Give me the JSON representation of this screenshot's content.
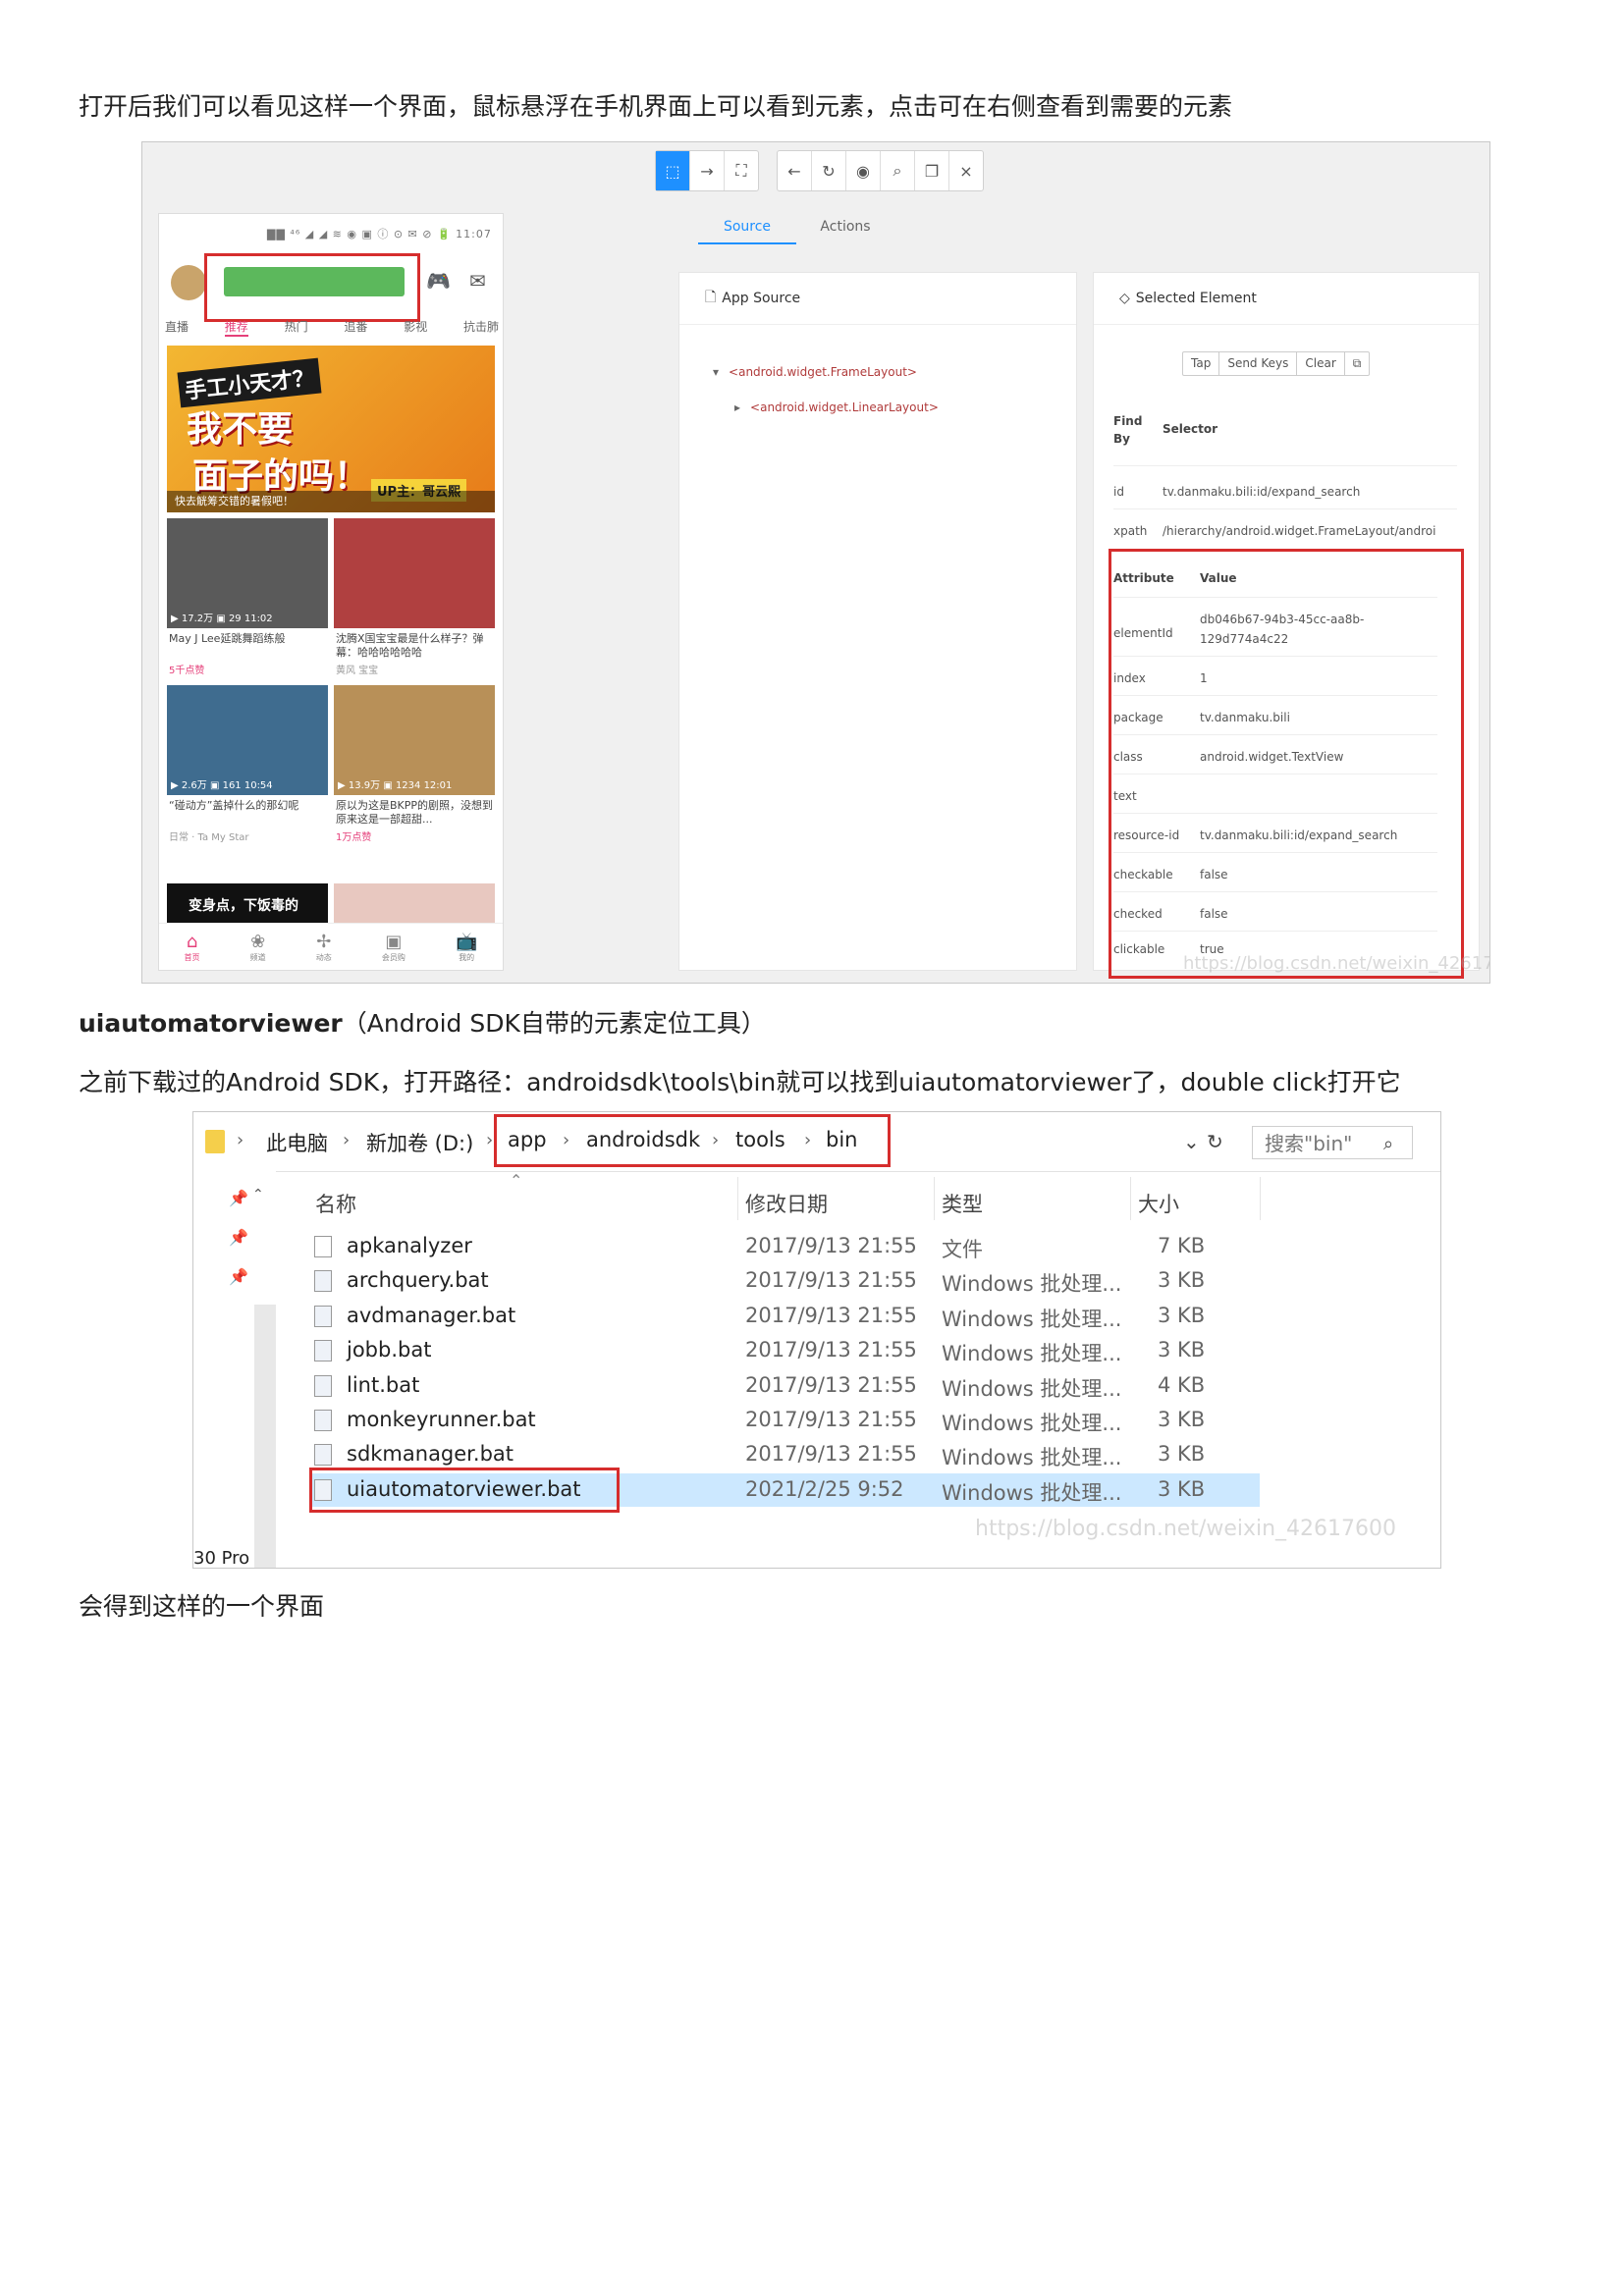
{
  "paragraphs": {
    "p1": "打开后我们可以看见这样一个界面，鼠标悬浮在手机界面上可以看到元素，点击可在右侧查看到需要的元素",
    "p2_bold": "uiautomatorviewer",
    "p2_rest": "（Android SDK自带的元素定位工具）",
    "p3": "之前下载过的Android SDK，打开路径：androidsdk\\tools\\bin就可以找到uiautomatorviewer了，double click打开它",
    "p4": "会得到这样的一个界面"
  },
  "inspector": {
    "toolbar_icons": [
      "select-icon",
      "swipe-icon",
      "tap-by-coordinates-icon",
      "back-icon",
      "refresh-icon",
      "eye-icon",
      "search-icon",
      "copy-icon",
      "close-icon"
    ],
    "tabs": [
      "Source",
      "Actions"
    ],
    "phone": {
      "status": "▇▇ ⁴⁶ ◢ ◢ ≋ ◉ ▣ ⓘ ⊙ ✉ ⊘ 🔋 11:07",
      "categories": [
        "直播",
        "推荐",
        "热门",
        "追番",
        "影视",
        "抗击肺"
      ],
      "banner": {
        "line1": "手工小天才？",
        "line2": "我不要",
        "line3": "面子的吗！",
        "up": "UP主：哥云熙",
        "foot": "快去觥筹交错的暑假吧！"
      },
      "cards": [
        {
          "stats": "▶ 17.2万  ▣ 29    11:02",
          "title": "May J Lee延跳舞蹈练般",
          "meta": "5千点赞"
        },
        {
          "stats": "",
          "title": "沈腾X国宝宝最是什么样子？弹幕：哈哈哈哈哈哈",
          "meta": "黄风 宝宝"
        },
        {
          "stats": "▶ 2.6万  ▣ 161   10:54",
          "title": "“碰动方”盖掉什么的那幻呢",
          "meta": "日常 · Ta My Star"
        },
        {
          "stats": "▶ 13.9万 ▣ 1234  12:01",
          "title": "原以为这是BKPP的剧照，没想到原来这是一部超甜...",
          "meta": "1万点赞"
        },
        {
          "stats": "",
          "title": "",
          "meta": ""
        },
        {
          "stats": "",
          "title": "",
          "meta": ""
        }
      ],
      "card5_text": "变身点，下饭毒的",
      "nav": [
        "首页",
        "频道",
        "动态",
        "会员购",
        "我的"
      ]
    },
    "source_panel": {
      "title": "App Source",
      "node1": "<android.widget.FrameLayout>",
      "node2": "<android.widget.LinearLayout>"
    },
    "selected_panel": {
      "title": "Selected Element",
      "buttons": [
        "Tap",
        "Send Keys",
        "Clear",
        "⧉"
      ],
      "selector_header": [
        "Find By",
        "Selector"
      ],
      "selectors": [
        {
          "by": "id",
          "value": "tv.danmaku.bili:id/expand_search"
        },
        {
          "by": "xpath",
          "value": "/hierarchy/android.widget.FrameLayout/androi"
        }
      ],
      "attr_header": [
        "Attribute",
        "Value"
      ],
      "attributes": [
        {
          "name": "elementId",
          "value": "db046b67-94b3-45cc-aa8b-",
          "value2": "129d774a4c22"
        },
        {
          "name": "index",
          "value": "1"
        },
        {
          "name": "package",
          "value": "tv.danmaku.bili"
        },
        {
          "name": "class",
          "value": "android.widget.TextView"
        },
        {
          "name": "text",
          "value": ""
        },
        {
          "name": "resource-id",
          "value": "tv.danmaku.bili:id/expand_search"
        },
        {
          "name": "checkable",
          "value": "false"
        },
        {
          "name": "checked",
          "value": "false"
        },
        {
          "name": "clickable",
          "value": "true"
        }
      ]
    },
    "watermark": "https://blog.csdn.net/weixin_42617600"
  },
  "explorer": {
    "breadcrumb": [
      "此电脑",
      "新加卷 (D:)",
      "app",
      "androidsdk",
      "tools",
      "bin"
    ],
    "search_placeholder": "搜索\"bin\"",
    "columns": [
      "名称",
      "修改日期",
      "类型",
      "大小"
    ],
    "files": [
      {
        "name": "apkanalyzer",
        "date": "2017/9/13 21:55",
        "type": "文件",
        "size": "7 KB"
      },
      {
        "name": "archquery.bat",
        "date": "2017/9/13 21:55",
        "type": "Windows 批处理...",
        "size": "3 KB"
      },
      {
        "name": "avdmanager.bat",
        "date": "2017/9/13 21:55",
        "type": "Windows 批处理...",
        "size": "3 KB"
      },
      {
        "name": "jobb.bat",
        "date": "2017/9/13 21:55",
        "type": "Windows 批处理...",
        "size": "3 KB"
      },
      {
        "name": "lint.bat",
        "date": "2017/9/13 21:55",
        "type": "Windows 批处理...",
        "size": "4 KB"
      },
      {
        "name": "monkeyrunner.bat",
        "date": "2017/9/13 21:55",
        "type": "Windows 批处理...",
        "size": "3 KB"
      },
      {
        "name": "sdkmanager.bat",
        "date": "2017/9/13 21:55",
        "type": "Windows 批处理...",
        "size": "3 KB"
      },
      {
        "name": "uiautomatorviewer.bat",
        "date": "2021/2/25 9:52",
        "type": "Windows 批处理...",
        "size": "3 KB"
      }
    ],
    "status_cutoff": "30 Pro",
    "watermark": "https://blog.csdn.net/weixin_42617600"
  },
  "colors": {
    "accent": "#1e90ff",
    "highlight_box": "#d62d2d",
    "selected_row": "#cce8ff",
    "search_green": "#5cb85c",
    "tab_pink": "#e5407a"
  }
}
